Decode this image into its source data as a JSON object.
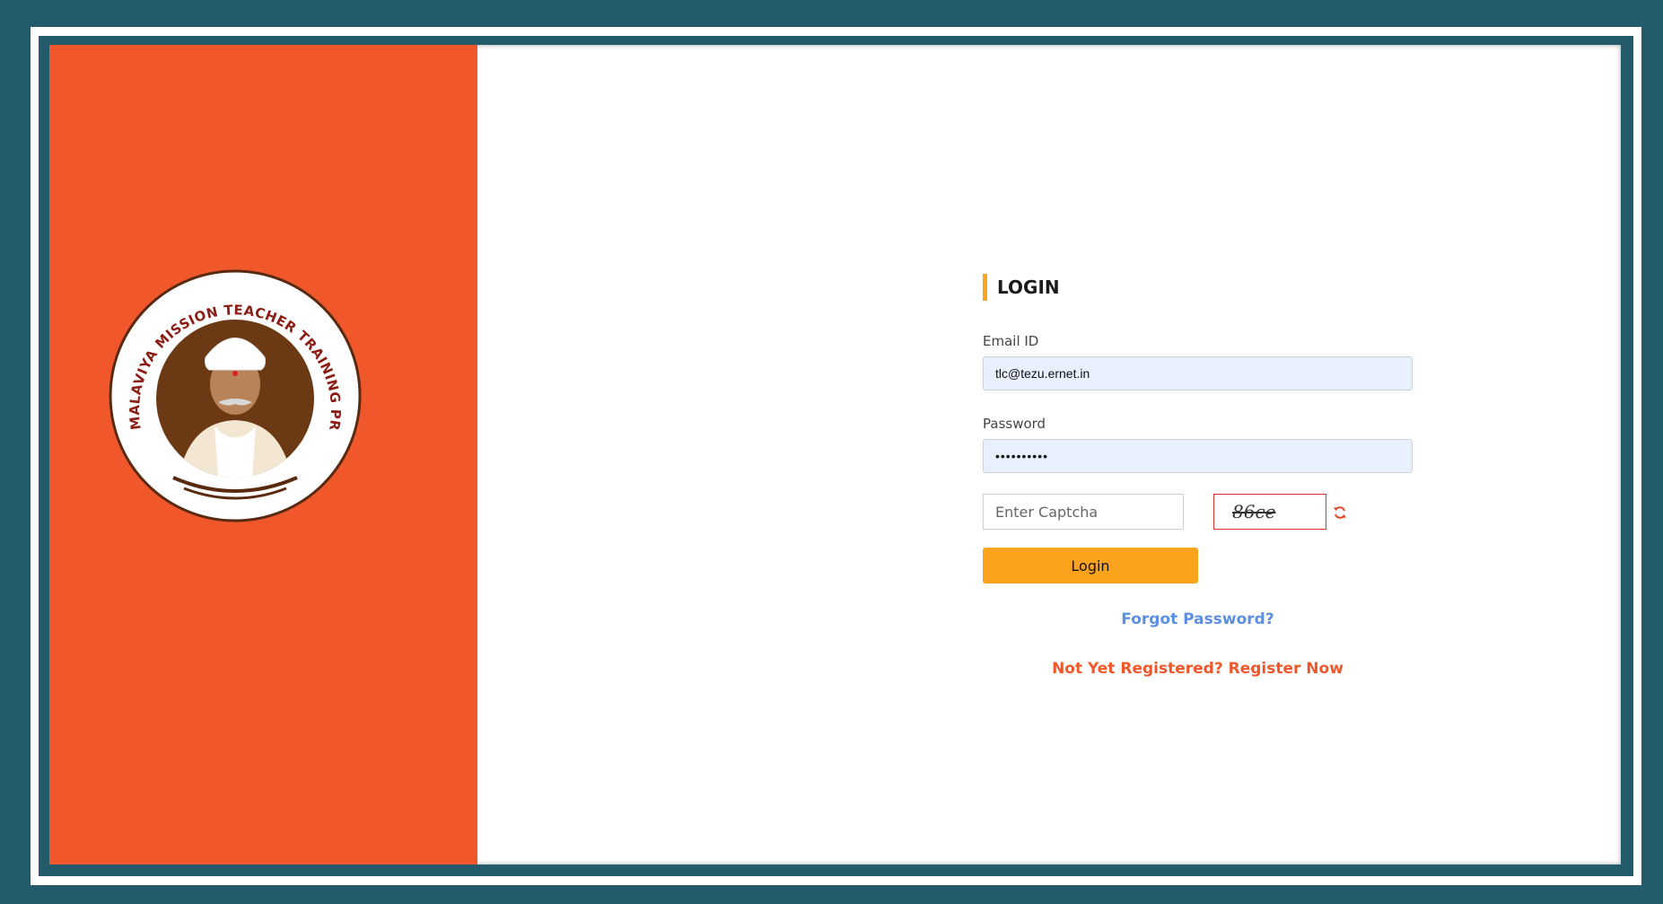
{
  "colors": {
    "outer_border": "#245b6b",
    "left_panel": "#f0572b",
    "accent_orange": "#fca31d",
    "forgot_link": "#5b8fe3",
    "register_link": "#f0572b",
    "logo_ring": "#8b1d14"
  },
  "logo": {
    "ring_text": "MALAVIYA MISSION TEACHER TRAINING PROGRAMME"
  },
  "login": {
    "title": "LOGIN",
    "email_label": "Email ID",
    "email_value": "tlc@tezu.ernet.in",
    "password_label": "Password",
    "password_value": "••••••••••",
    "captcha_placeholder": "Enter Captcha",
    "captcha_text": "86ce",
    "refresh_icon": "refresh-icon",
    "login_button": "Login",
    "forgot_password": "Forgot Password?",
    "register": "Not Yet Registered? Register Now"
  }
}
